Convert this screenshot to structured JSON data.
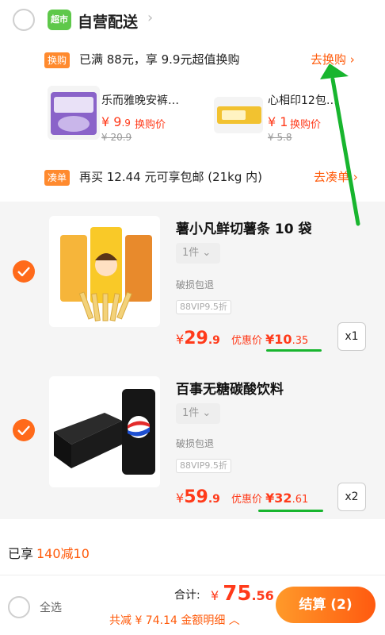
{
  "store": {
    "badge": "超市",
    "name": "自营配送"
  },
  "swap_promo": {
    "tag": "换购",
    "text": "已满 88元，享 9.9元超值换购",
    "link": "去换购",
    "items": [
      {
        "name": "乐而雅晚安裤…",
        "price_int": "¥ 9",
        "price_frac": ".9",
        "label": "换购价",
        "original": "¥ 20.9"
      },
      {
        "name": "心相印12包…",
        "price_int": "¥ 1",
        "price_frac": "",
        "label": "换购价",
        "original": "¥ 5.8"
      }
    ]
  },
  "bundle_promo": {
    "tag": "凑单",
    "text": "再买 12.44 元可享包邮 (21kg 内)",
    "link": "去凑单"
  },
  "products": [
    {
      "name": "薯小凡鲜切薯条 10 袋",
      "spec": "1件",
      "service": "破损包退",
      "vip": "88VIP9.5折",
      "price_int": "29",
      "price_frac": ".9",
      "discount_label": "优惠价",
      "discount_int": "¥10",
      "discount_frac": ".35",
      "quantity": "x1",
      "checked": true
    },
    {
      "name": "百事无糖碳酸饮料",
      "spec": "1件",
      "service": "破损包退",
      "vip": "88VIP9.5折",
      "price_int": "59",
      "price_frac": ".9",
      "discount_label": "优惠价",
      "discount_int": "¥32",
      "discount_frac": ".61",
      "quantity": "x2",
      "checked": true
    }
  ],
  "saved_promo": {
    "prefix": "已享",
    "value": "140减10"
  },
  "checkout": {
    "select_all": "全选",
    "total_label": "合计:",
    "total_int": "75",
    "total_frac": ".56",
    "savings": "共减 ¥ 74.14  金额明细 ︿",
    "button": "结算 (2)"
  },
  "colors": {
    "accent": "#ff5a0a",
    "price": "#ff3a1a",
    "annotation": "#18b52e"
  }
}
